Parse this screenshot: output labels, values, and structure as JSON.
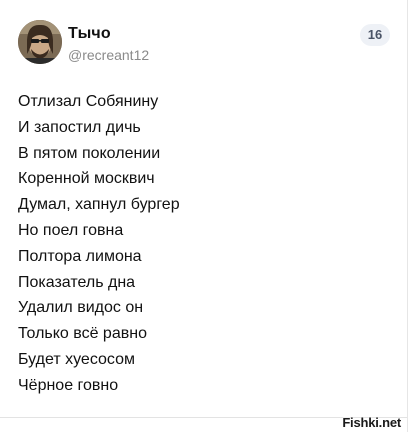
{
  "post": {
    "author_name": "Тычо",
    "author_handle": "@recreant12",
    "count_badge": "16",
    "lines": [
      "Отлизал Собянину",
      "И запостил дичь",
      "В пятом поколении",
      "Коренной москвич",
      "Думал, хапнул бургер",
      "Но поел говна",
      "Полтора лимона",
      "Показатель дна",
      "Удалил видос он",
      "Только всё равно",
      "Будет хуесосом",
      "Чёрное говно"
    ]
  },
  "watermark": "Fishki.net",
  "icons": {
    "avatar": "user-avatar-photo"
  }
}
